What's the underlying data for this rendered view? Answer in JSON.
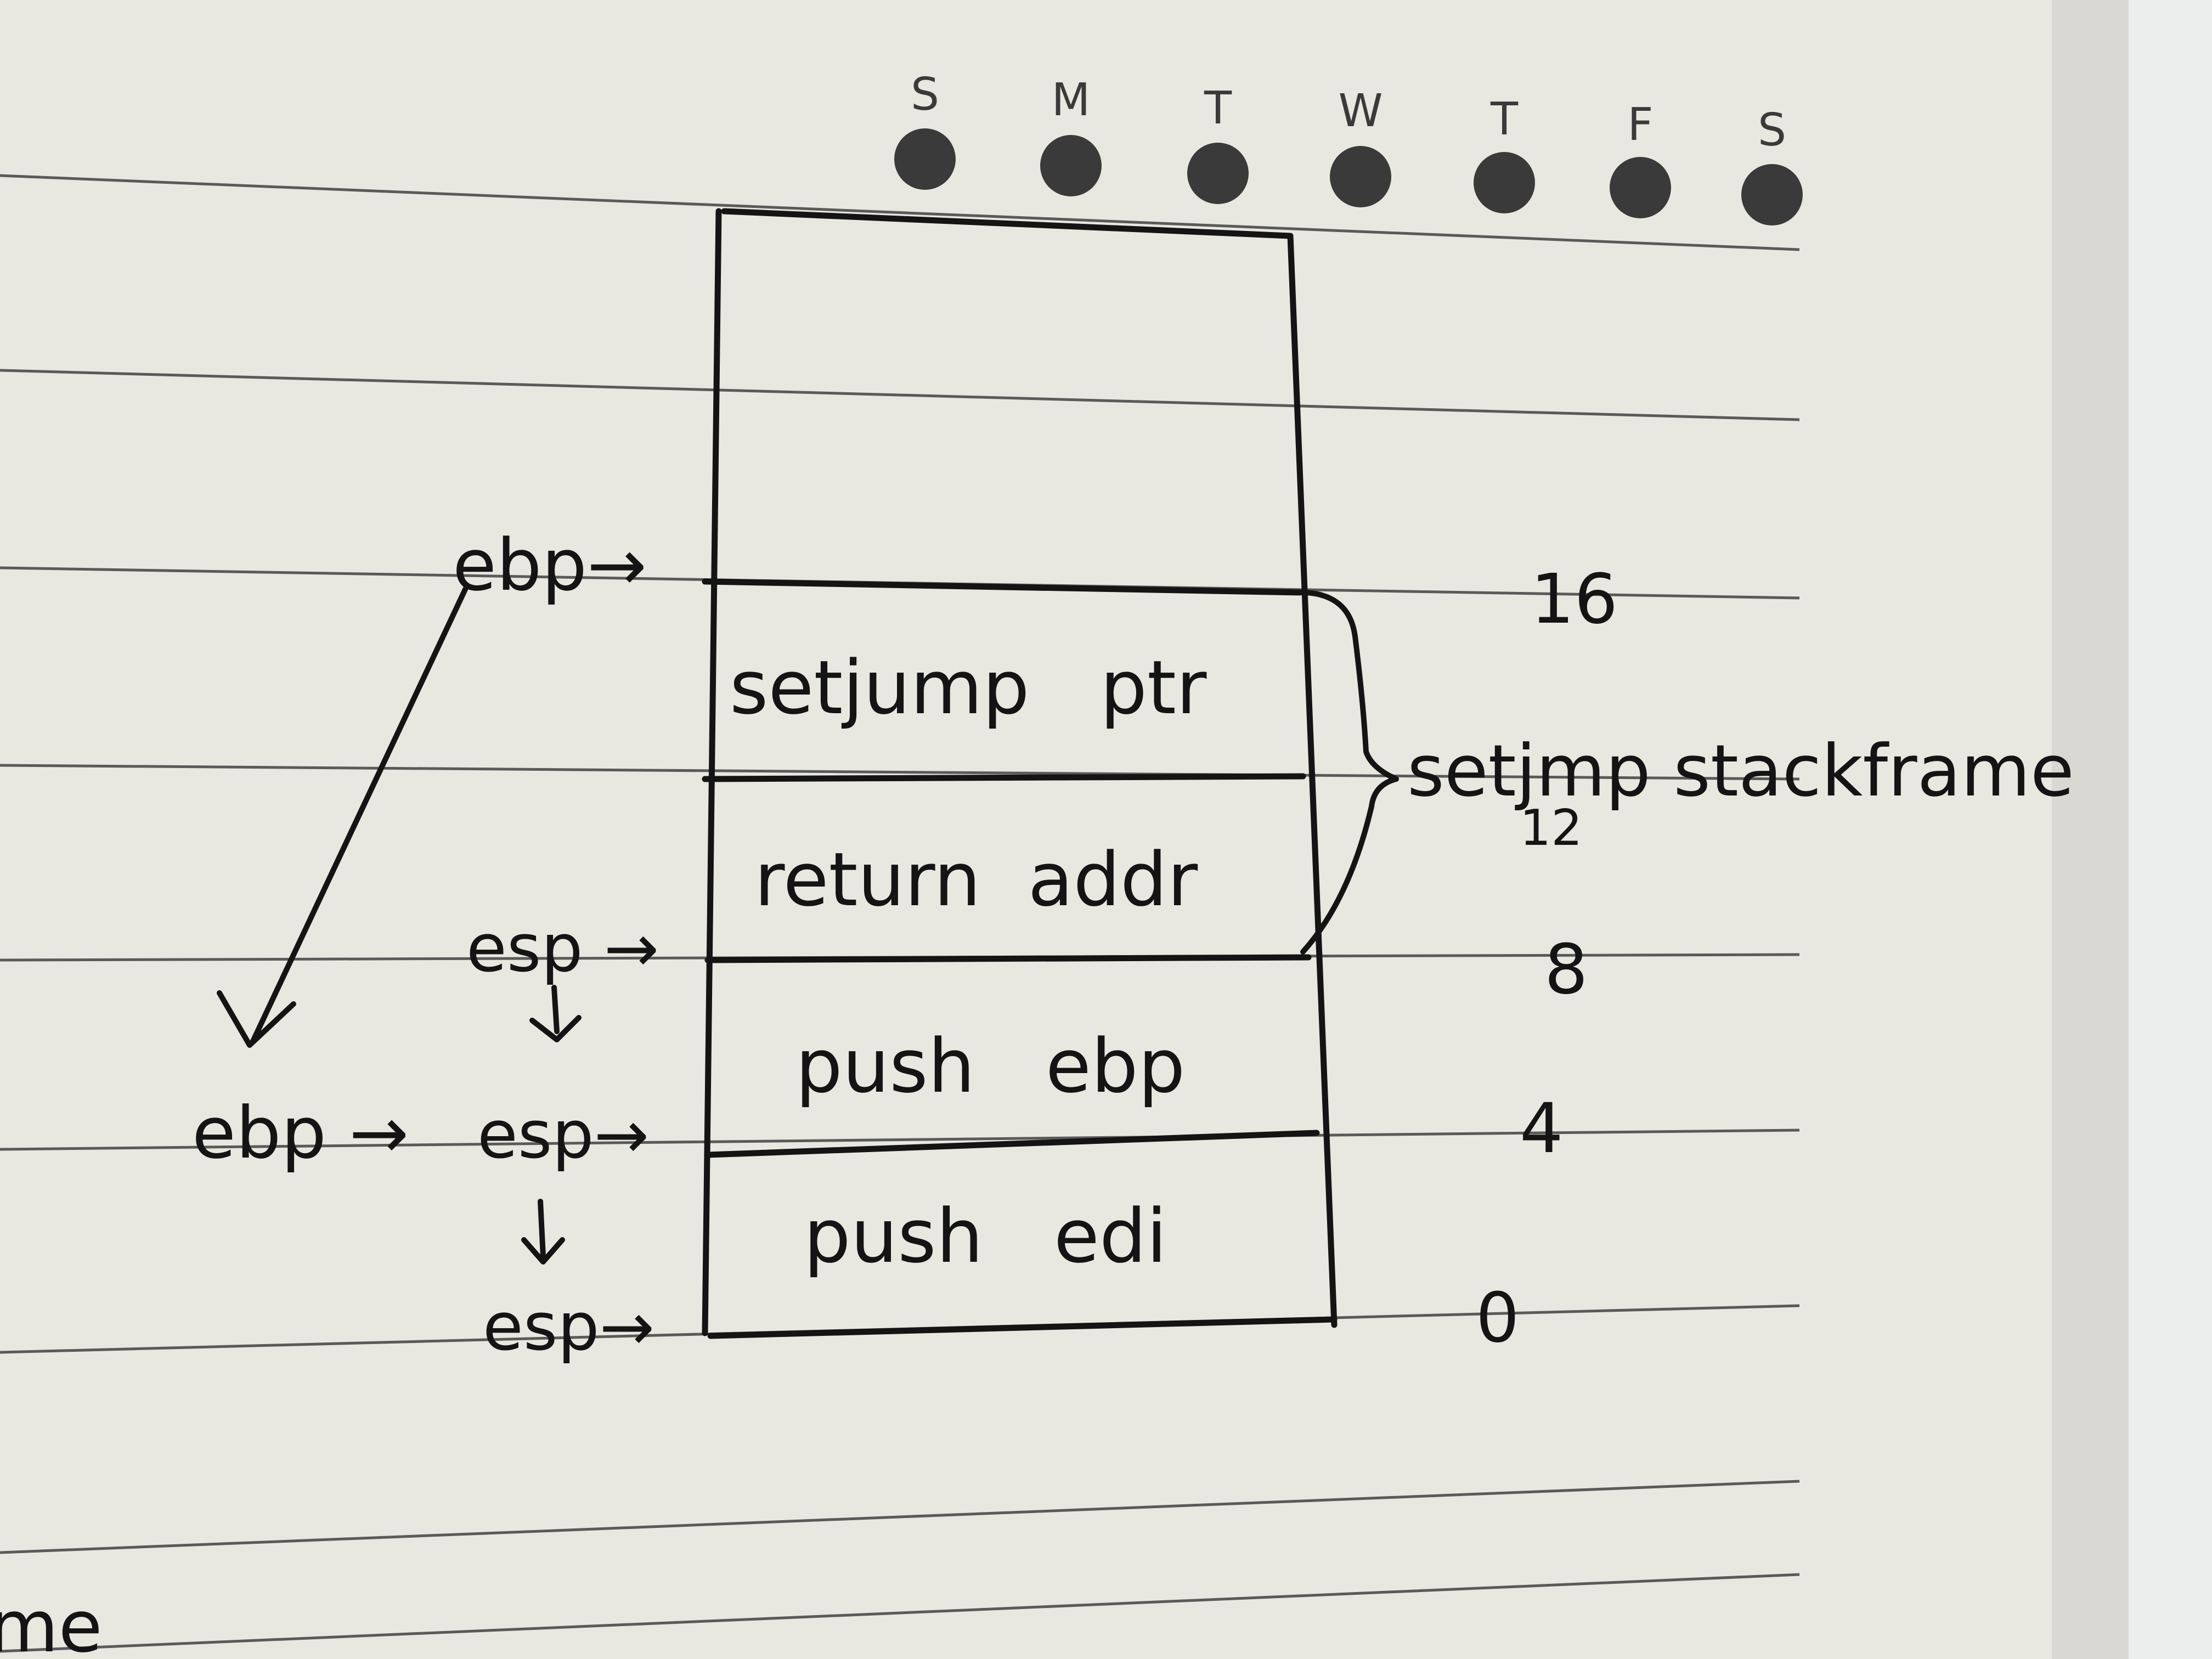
{
  "weekdays": [
    "S",
    "M",
    "T",
    "W",
    "T",
    "F",
    "S"
  ],
  "stack_cells": {
    "top_empty": "",
    "setjump_ptr": "setjump   ptr",
    "return_addr": "return  addr",
    "push_ebp": "push   ebp",
    "push_edi": "push   edi"
  },
  "offsets": {
    "o16": "16",
    "o12": "12",
    "o8": "8",
    "o4": "4",
    "o0": "0"
  },
  "brace_label": "setjmp stackframe",
  "pointers": {
    "ebp_top": "ebp→",
    "esp_mid": "esp →",
    "ebp_low": "ebp →",
    "esp_low": "esp→",
    "esp_bottom": "esp→"
  },
  "corner_text": "me",
  "colors": {
    "paper": "#e9e8e0",
    "ink": "#141414",
    "rule_line": "#5a5a5a",
    "dot": "#3a3a3a"
  }
}
